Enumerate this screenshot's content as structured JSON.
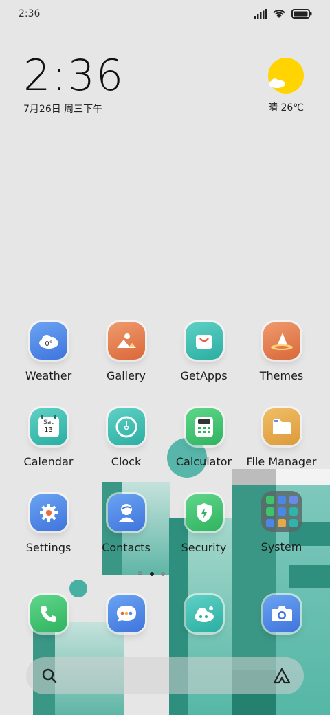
{
  "status_bar": {
    "time": "2:36"
  },
  "clock": {
    "time": "2:36",
    "date": "7月26日 周三下午"
  },
  "weather": {
    "text": "晴 26℃"
  },
  "apps": [
    {
      "label": "Weather",
      "color": "#4c86e8",
      "icon": "cloud-icon"
    },
    {
      "label": "Gallery",
      "color": "#e37b4f",
      "icon": "mountain-image-icon"
    },
    {
      "label": "GetApps",
      "color": "#37bdb0",
      "icon": "shopping-bag-icon"
    },
    {
      "label": "Themes",
      "color": "#e3784a",
      "icon": "wizard-hat-icon"
    },
    {
      "label": "Calendar",
      "color": "#3ab5a8",
      "icon": "calendar-icon",
      "day": "Sat",
      "date": "13"
    },
    {
      "label": "Clock",
      "color": "#2fb3ad",
      "icon": "clock-icon"
    },
    {
      "label": "Calculator",
      "color": "#3ec46a",
      "icon": "calculator-icon"
    },
    {
      "label": "File Manager",
      "color": "#e5a84a",
      "icon": "folder-icon"
    },
    {
      "label": "Settings",
      "color": "#4c86e8",
      "icon": "gear-icon"
    },
    {
      "label": "Contacts",
      "color": "#4c86e8",
      "icon": "person-icon"
    },
    {
      "label": "Security",
      "color": "#3ec46a",
      "icon": "shield-icon"
    },
    {
      "label": "System",
      "color": "#5a6b6a",
      "icon": "folder-grid-icon"
    }
  ],
  "dock": [
    {
      "name": "phone",
      "color": "#3ec46a",
      "icon": "phone-icon"
    },
    {
      "name": "messages",
      "color": "#4c86e8",
      "icon": "message-icon"
    },
    {
      "name": "cloud",
      "color": "#2fb3ad",
      "icon": "cloud-face-icon"
    },
    {
      "name": "camera",
      "color": "#4c86e8",
      "icon": "camera-icon"
    }
  ]
}
